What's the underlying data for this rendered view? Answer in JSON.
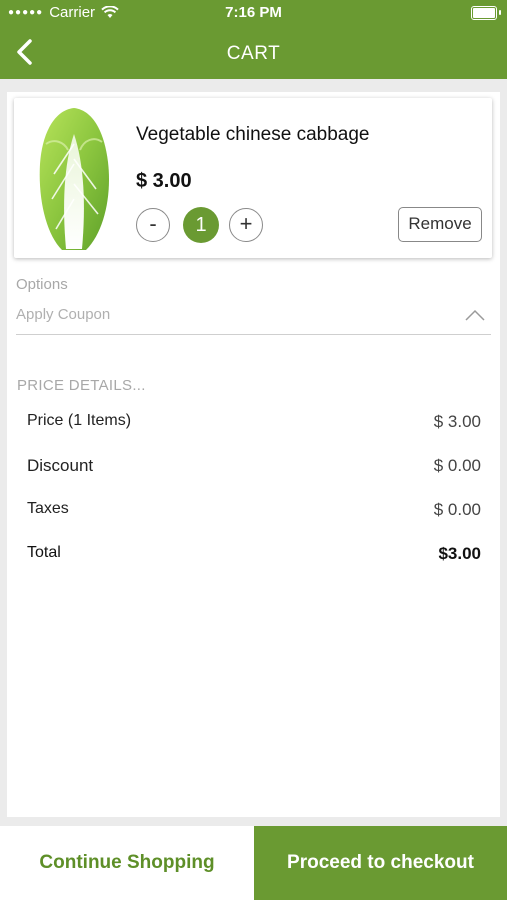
{
  "status_bar": {
    "carrier": "Carrier",
    "time": "7:16 PM"
  },
  "header": {
    "title": "CART",
    "back_icon": "chevron-left-icon"
  },
  "cart_item": {
    "name": "Vegetable chinese cabbage",
    "price": "$ 3.00",
    "decrement_label": "-",
    "quantity": "1",
    "increment_label": "+",
    "remove_label": "Remove"
  },
  "options": {
    "label": "Options",
    "coupon_placeholder": "Apply Coupon",
    "coupon_icon": "chevron-up-icon"
  },
  "price_details": {
    "title": "PRICE DETAILS...",
    "rows": [
      {
        "label": "Price (1 Items)",
        "value": "$ 3.00"
      },
      {
        "label": "Discount",
        "value": "$ 0.00"
      },
      {
        "label": "Taxes",
        "value": "$ 0.00"
      }
    ],
    "total_label": "Total",
    "total_value": "$3.00"
  },
  "footer": {
    "continue_label": "Continue Shopping",
    "checkout_label": "Proceed to checkout"
  },
  "colors": {
    "brand_green": "#6a9a32",
    "text_green": "#5e8f28"
  }
}
